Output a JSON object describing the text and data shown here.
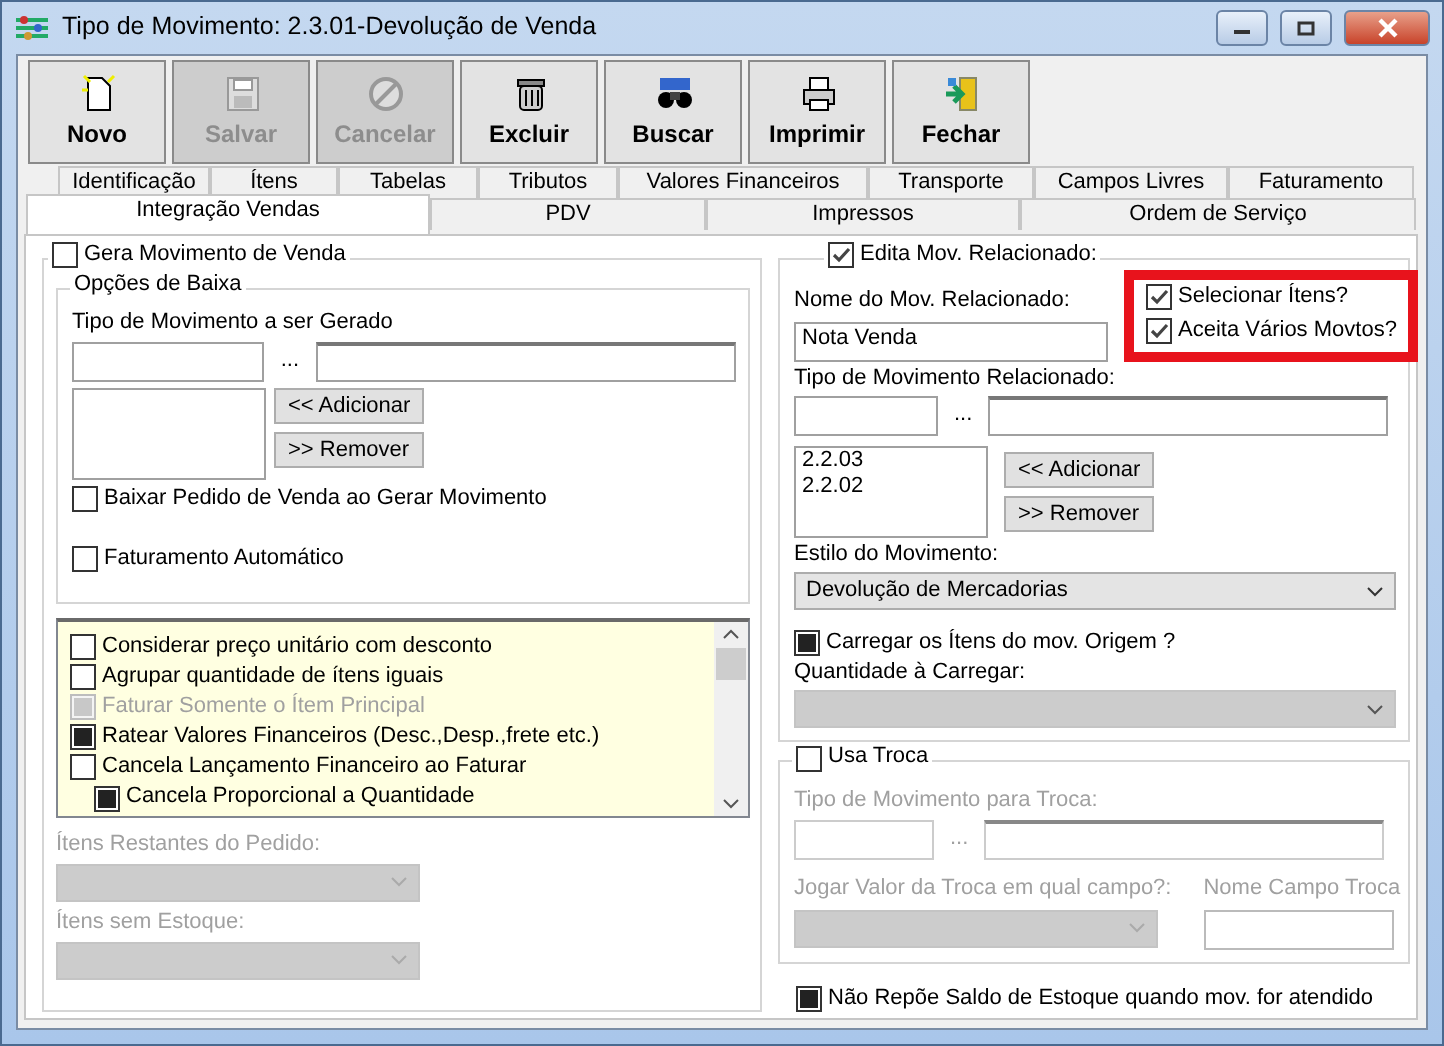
{
  "window": {
    "title": "Tipo de Movimento: 2.3.01-Devolução de Venda"
  },
  "toolbar": [
    {
      "label": "Novo",
      "disabled": false
    },
    {
      "label": "Salvar",
      "disabled": true
    },
    {
      "label": "Cancelar",
      "disabled": true
    },
    {
      "label": "Excluir",
      "disabled": false
    },
    {
      "label": "Buscar",
      "disabled": false
    },
    {
      "label": "Imprimir",
      "disabled": false
    },
    {
      "label": "Fechar",
      "disabled": false
    }
  ],
  "tab_rows": [
    [
      {
        "label": "Identificação",
        "selected": false
      },
      {
        "label": "Ítens",
        "selected": false
      },
      {
        "label": "Tabelas",
        "selected": false
      },
      {
        "label": "Tributos",
        "selected": false
      },
      {
        "label": "Valores Financeiros",
        "selected": false
      },
      {
        "label": "Transporte",
        "selected": false
      },
      {
        "label": "Campos Livres",
        "selected": false
      },
      {
        "label": "Faturamento",
        "selected": false
      }
    ],
    [
      {
        "label": "Integração Vendas",
        "selected": true
      },
      {
        "label": "PDV",
        "selected": false
      },
      {
        "label": "Impressos",
        "selected": false
      },
      {
        "label": "Ordem de Serviço",
        "selected": false
      }
    ]
  ],
  "left": {
    "header_checkbox": {
      "label": "Gera Movimento de Venda",
      "checked": false,
      "disabled": false
    },
    "group": {
      "legend": "Opções de Baixa",
      "field_label": "Tipo de Movimento a ser Gerado",
      "ellipsis": "...",
      "add_button": "<< Adicionar",
      "remove_button": ">> Remover",
      "checkboxes": [
        {
          "label": "Baixar Pedido de Venda ao Gerar Movimento",
          "checked": false,
          "disabled": false
        },
        {
          "label": "Faturamento Automático",
          "checked": false,
          "disabled": false
        }
      ]
    },
    "options": [
      {
        "label": "Considerar preço unitário com desconto",
        "checked": false,
        "disabled": false
      },
      {
        "label": "Agrupar quantidade de ítens iguais",
        "checked": false,
        "disabled": false
      },
      {
        "label": "Faturar Somente o Ítem Principal",
        "checked": false,
        "indeterminate": true,
        "disabled": true
      },
      {
        "label": "Ratear Valores Financeiros (Desc.,Desp.,frete etc.)",
        "checked": false,
        "indeterminate": true,
        "disabled": false
      },
      {
        "label": "Cancela Lançamento Financeiro ao Faturar",
        "checked": false,
        "disabled": false,
        "children": [
          {
            "label": "Cancela Proporcional a Quantidade",
            "checked": false,
            "indeterminate": true,
            "disabled": false
          }
        ]
      }
    ],
    "selects": [
      {
        "label": "Ítens Restantes do Pedido:",
        "disabled": true
      },
      {
        "label": "Ítens sem Estoque:",
        "disabled": true
      }
    ]
  },
  "right": {
    "edit_checkbox": {
      "label": "Edita Mov. Relacionado:",
      "checked": true,
      "disabled": false
    },
    "name_label": "Nome do Mov. Relacionado:",
    "name_value": "Nota Venda",
    "highlighted_checkboxes": [
      {
        "label": "Selecionar Ítens?",
        "checked": true,
        "disabled": false
      },
      {
        "label": "Aceita Vários Movtos?",
        "checked": true,
        "disabled": false
      }
    ],
    "type_label": "Tipo de Movimento Relacionado:",
    "ellipsis": "...",
    "list_items": [
      "2.2.03",
      "2.2.02"
    ],
    "add_button": "<< Adicionar",
    "remove_button": ">> Remover",
    "style_label": "Estilo do Movimento:",
    "style_value": "Devolução de Mercadorias",
    "load_checkbox": {
      "label": "Carregar os Ítens do mov. Origem ?",
      "checked": false,
      "indeterminate": true,
      "disabled": false
    },
    "quantity_label": "Quantidade à Carregar:",
    "quantity_disabled": true
  },
  "troca": {
    "checkbox": {
      "label": "Usa Troca",
      "checked": false,
      "disabled": false
    },
    "type_label": "Tipo de Movimento para Troca:",
    "ellipsis": "...",
    "field_label": "Jogar Valor da Troca em qual campo?:",
    "name_label": "Nome Campo Troca",
    "disabled": true
  },
  "bottom_checkbox": {
    "label": "Não Repõe Saldo de Estoque quando mov. for atendido",
    "checked": false,
    "indeterminate": true,
    "disabled": false
  }
}
